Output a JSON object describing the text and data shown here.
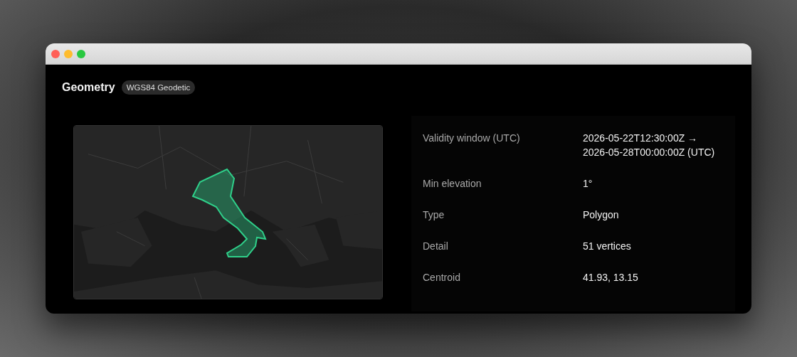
{
  "window": {
    "controls": [
      {
        "kind": "close"
      },
      {
        "kind": "minimize"
      },
      {
        "kind": "zoom"
      }
    ]
  },
  "header": {
    "title": "Geometry",
    "badge": "WGS84 Geodetic"
  },
  "details": [
    {
      "label": "Validity window (UTC)",
      "value": "2026-05-22T12:30:00Z → 2026-05-28T00:00:00Z (UTC)"
    },
    {
      "label": "Min elevation",
      "value": "1°"
    },
    {
      "label": "Type",
      "value": "Polygon"
    },
    {
      "label": "Detail",
      "value": "51 vertices"
    },
    {
      "label": "Centroid",
      "value": "41.93, 13.15"
    }
  ]
}
